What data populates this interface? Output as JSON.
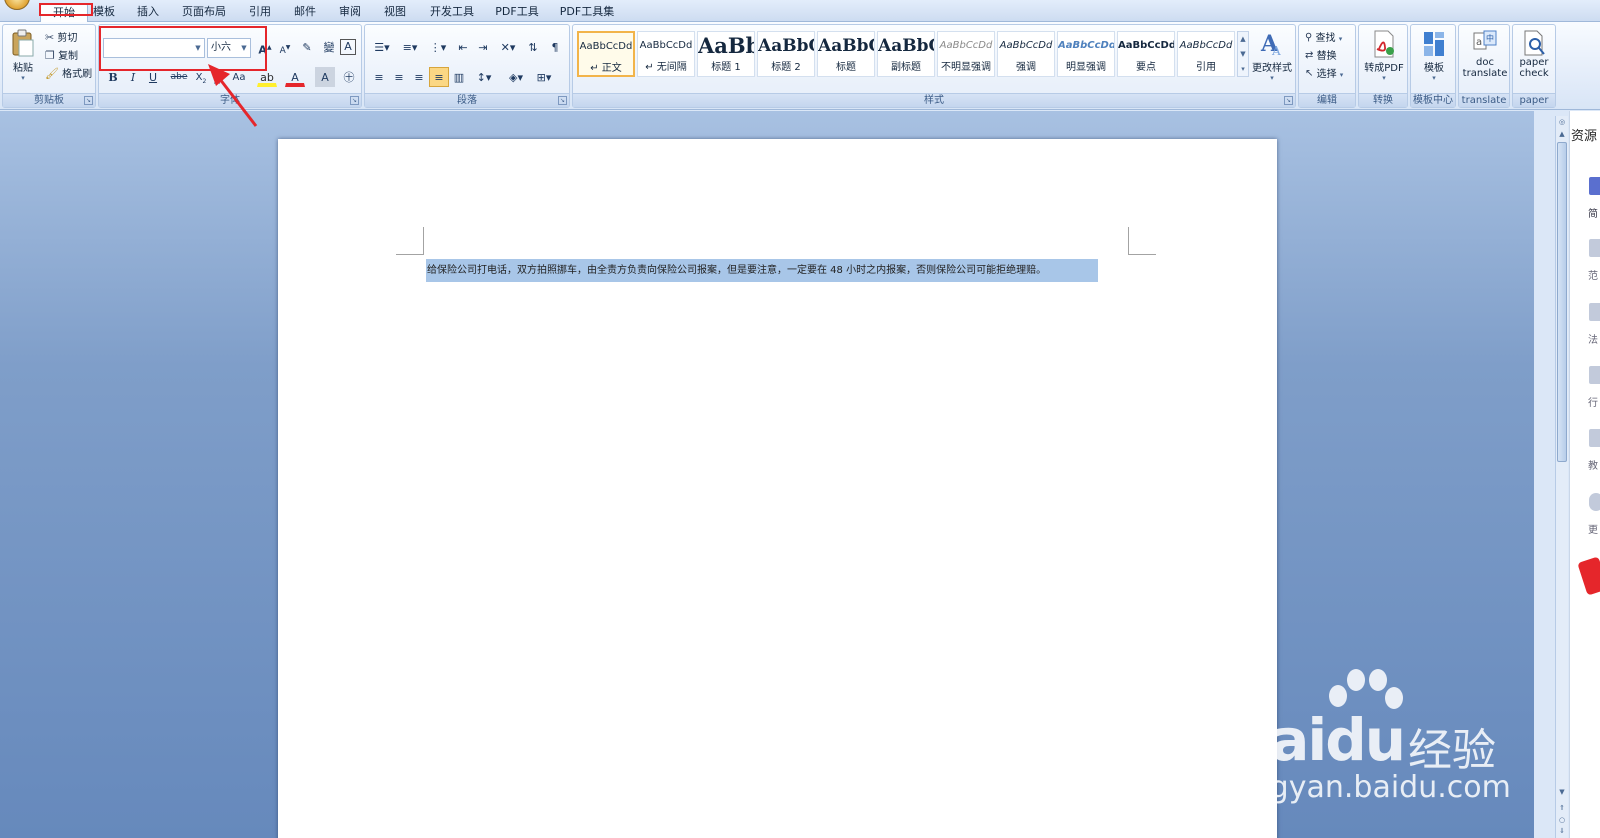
{
  "tabs": [
    "开始",
    "模板",
    "插入",
    "页面布局",
    "引用",
    "邮件",
    "审阅",
    "视图",
    "开发工具",
    "PDF工具",
    "PDF工具集"
  ],
  "clipboard": {
    "label": "剪贴板",
    "paste": "粘贴",
    "cut": "剪切",
    "copy": "复制",
    "format_painter": "格式刷"
  },
  "font": {
    "label": "字体",
    "name_value": "",
    "size_value": "小六"
  },
  "paragraph": {
    "label": "段落"
  },
  "styles": {
    "label": "样式",
    "items": [
      {
        "preview": "AaBbCcDd",
        "name": "↵ 正文"
      },
      {
        "preview": "AaBbCcDd",
        "name": "↵ 无间隔"
      },
      {
        "preview": "AaBb",
        "name": "标题 1"
      },
      {
        "preview": "AaBbC",
        "name": "标题 2"
      },
      {
        "preview": "AaBbC",
        "name": "标题"
      },
      {
        "preview": "AaBbC",
        "name": "副标题"
      },
      {
        "preview": "AaBbCcDd",
        "name": "不明显强调"
      },
      {
        "preview": "AaBbCcDd",
        "name": "强调"
      },
      {
        "preview": "AaBbCcDd",
        "name": "明显强调"
      },
      {
        "preview": "AaBbCcDd",
        "name": "要点"
      },
      {
        "preview": "AaBbCcDd",
        "name": "引用"
      }
    ],
    "change_styles": "更改样式"
  },
  "editing": {
    "label": "编辑",
    "find": "查找",
    "replace": "替换",
    "select": "选择"
  },
  "convert": {
    "label": "转换",
    "to_pdf": "转成PDF"
  },
  "template_center": {
    "label": "模板中心",
    "template": "模板"
  },
  "translate": {
    "label": "translate",
    "line1": "doc",
    "line2": "translate"
  },
  "paper": {
    "label": "paper",
    "line1": "paper",
    "line2": "check"
  },
  "document": {
    "text": "给保险公司打电话，双方拍照挪车，由全责方负责向保险公司报案，但是要注意，一定要在 48 小时之内报案，否则保险公司可能拒绝理赔。"
  },
  "side_panel": {
    "title": "资源",
    "items": [
      "简",
      "范",
      "法",
      "行",
      "教",
      "更"
    ]
  },
  "watermark": {
    "logo": "Baidu",
    "cn": "经验",
    "url": "jingyan.baidu.com"
  },
  "colors": {
    "annotation": "#e5262b",
    "selection": "#a8c6e8",
    "ribbon": "#dbe7f7"
  }
}
